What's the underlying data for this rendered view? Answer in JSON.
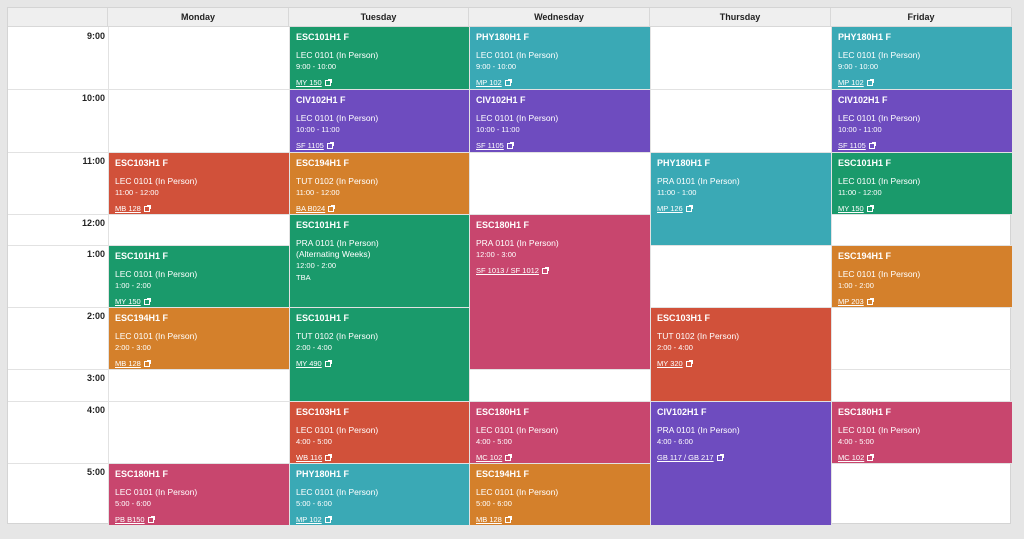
{
  "days": [
    "Monday",
    "Tuesday",
    "Wednesday",
    "Thursday",
    "Friday"
  ],
  "time_labels": [
    "9:00",
    "10:00",
    "11:00",
    "12:00",
    "1:00",
    "2:00",
    "3:00",
    "4:00",
    "5:00"
  ],
  "colors": {
    "green": "#1a9a6b",
    "teal": "#3aa9b5",
    "purple": "#6e4cbf",
    "orange": "#d4802b",
    "red": "#d1513a",
    "pink": "#c8466e"
  },
  "events": [
    {
      "id": "tue-esc101-900",
      "day": "Tuesday",
      "code": "ESC101H1 F",
      "section": "LEC 0101 (In Person)",
      "time": "9:00 - 10:00",
      "room": "MY 150",
      "color": "green"
    },
    {
      "id": "wed-phy180-900",
      "day": "Wednesday",
      "code": "PHY180H1 F",
      "section": "LEC 0101 (In Person)",
      "time": "9:00 - 10:00",
      "room": "MP 102",
      "color": "teal"
    },
    {
      "id": "fri-phy180-900",
      "day": "Friday",
      "code": "PHY180H1 F",
      "section": "LEC 0101 (In Person)",
      "time": "9:00 - 10:00",
      "room": "MP 102",
      "color": "teal"
    },
    {
      "id": "tue-civ102-1000",
      "day": "Tuesday",
      "code": "CIV102H1 F",
      "section": "LEC 0101 (In Person)",
      "time": "10:00 - 11:00",
      "room": "SF 1105",
      "color": "purple"
    },
    {
      "id": "wed-civ102-1000",
      "day": "Wednesday",
      "code": "CIV102H1 F",
      "section": "LEC 0101 (In Person)",
      "time": "10:00 - 11:00",
      "room": "SF 1105",
      "color": "purple"
    },
    {
      "id": "fri-civ102-1000",
      "day": "Friday",
      "code": "CIV102H1 F",
      "section": "LEC 0101 (In Person)",
      "time": "10:00 - 11:00",
      "room": "SF 1105",
      "color": "purple"
    },
    {
      "id": "mon-esc103-1100",
      "day": "Monday",
      "code": "ESC103H1 F",
      "section": "LEC 0101 (In Person)",
      "time": "11:00 - 12:00",
      "room": "MB 128",
      "color": "red"
    },
    {
      "id": "tue-esc194-1100",
      "day": "Tuesday",
      "code": "ESC194H1 F",
      "section": "TUT 0102 (In Person)",
      "time": "11:00 - 12:00",
      "room": "BA B024",
      "color": "orange"
    },
    {
      "id": "thu-phy180-1100",
      "day": "Thursday",
      "code": "PHY180H1 F",
      "section": "PRA 0101 (In Person)",
      "time": "11:00 - 1:00",
      "room": "MP 126",
      "color": "teal"
    },
    {
      "id": "fri-esc101-1100",
      "day": "Friday",
      "code": "ESC101H1 F",
      "section": "LEC 0101 (In Person)",
      "time": "11:00 - 12:00",
      "room": "MY 150",
      "color": "green"
    },
    {
      "id": "tue-esc101-1200",
      "day": "Tuesday",
      "code": "ESC101H1 F",
      "section": "PRA 0101 (In Person)",
      "section2": "(Alternating Weeks)",
      "time": "12:00 - 2:00",
      "tba": "TBA",
      "color": "green"
    },
    {
      "id": "wed-esc180-1200",
      "day": "Wednesday",
      "code": "ESC180H1 F",
      "section": "PRA 0101 (In Person)",
      "time": "12:00 - 3:00",
      "room": "SF 1013 / SF 1012",
      "color": "pink"
    },
    {
      "id": "mon-esc101-100",
      "day": "Monday",
      "code": "ESC101H1 F",
      "section": "LEC 0101 (In Person)",
      "time": "1:00 - 2:00",
      "room": "MY 150",
      "color": "green"
    },
    {
      "id": "fri-esc194-100",
      "day": "Friday",
      "code": "ESC194H1 F",
      "section": "LEC 0101 (In Person)",
      "time": "1:00 - 2:00",
      "room": "MP 203",
      "color": "orange"
    },
    {
      "id": "mon-esc194-200",
      "day": "Monday",
      "code": "ESC194H1 F",
      "section": "LEC 0101 (In Person)",
      "time": "2:00 - 3:00",
      "room": "MB 128",
      "color": "orange"
    },
    {
      "id": "tue-esc101-200",
      "day": "Tuesday",
      "code": "ESC101H1 F",
      "section": "TUT 0102 (In Person)",
      "time": "2:00 - 4:00",
      "room": "MY 490",
      "color": "green"
    },
    {
      "id": "thu-esc103-200",
      "day": "Thursday",
      "code": "ESC103H1 F",
      "section": "TUT 0102 (In Person)",
      "time": "2:00 - 4:00",
      "room": "MY 320",
      "color": "red"
    },
    {
      "id": "tue-esc103-400",
      "day": "Tuesday",
      "code": "ESC103H1 F",
      "section": "LEC 0101 (In Person)",
      "time": "4:00 - 5:00",
      "room": "WB 116",
      "color": "red"
    },
    {
      "id": "wed-esc180-400",
      "day": "Wednesday",
      "code": "ESC180H1 F",
      "section": "LEC 0101 (In Person)",
      "time": "4:00 - 5:00",
      "room": "MC 102",
      "color": "pink"
    },
    {
      "id": "thu-civ102-400",
      "day": "Thursday",
      "code": "CIV102H1 F",
      "section": "PRA 0101 (In Person)",
      "time": "4:00 - 6:00",
      "room": "GB 117 / GB 217",
      "color": "purple"
    },
    {
      "id": "fri-esc180-400",
      "day": "Friday",
      "code": "ESC180H1 F",
      "section": "LEC 0101 (In Person)",
      "time": "4:00 - 5:00",
      "room": "MC 102",
      "color": "pink"
    },
    {
      "id": "mon-esc180-500",
      "day": "Monday",
      "code": "ESC180H1 F",
      "section": "LEC 0101 (In Person)",
      "time": "5:00 - 6:00",
      "room": "PB B150",
      "color": "pink"
    },
    {
      "id": "tue-phy180-500",
      "day": "Tuesday",
      "code": "PHY180H1 F",
      "section": "LEC 0101 (In Person)",
      "time": "5:00 - 6:00",
      "room": "MP 102",
      "color": "teal"
    },
    {
      "id": "wed-esc194-500",
      "day": "Wednesday",
      "code": "ESC194H1 F",
      "section": "LEC 0101 (In Person)",
      "time": "5:00 - 6:00",
      "room": "MB 128",
      "color": "orange"
    }
  ]
}
